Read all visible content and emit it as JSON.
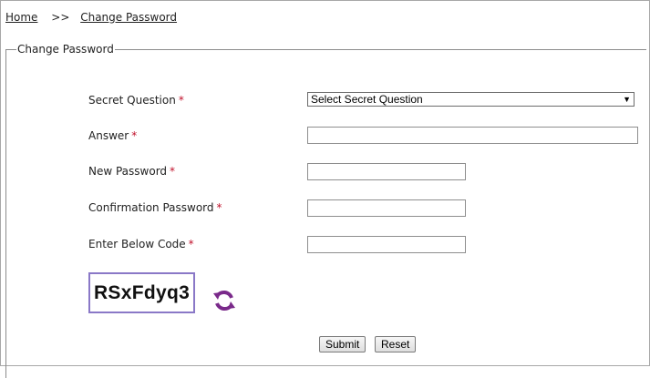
{
  "breadcrumb": {
    "home": "Home",
    "separator": ">>",
    "current": "Change Password"
  },
  "form": {
    "legend": "Change Password",
    "required_marker": "*",
    "secret_question": {
      "label": "Secret Question",
      "selected": "Select Secret Question"
    },
    "answer": {
      "label": "Answer",
      "value": ""
    },
    "new_password": {
      "label": "New Password",
      "value": ""
    },
    "confirm_password": {
      "label": "Confirmation Password",
      "value": ""
    },
    "code": {
      "label": "Enter Below Code",
      "value": ""
    },
    "captcha_text": "RSxFdyq3",
    "refresh_icon": "refresh-icon",
    "buttons": {
      "submit": "Submit",
      "reset": "Reset"
    }
  },
  "colors": {
    "required": "#c0102a",
    "captcha_border": "#8a78c7",
    "refresh_icon": "#7a2a8a"
  }
}
